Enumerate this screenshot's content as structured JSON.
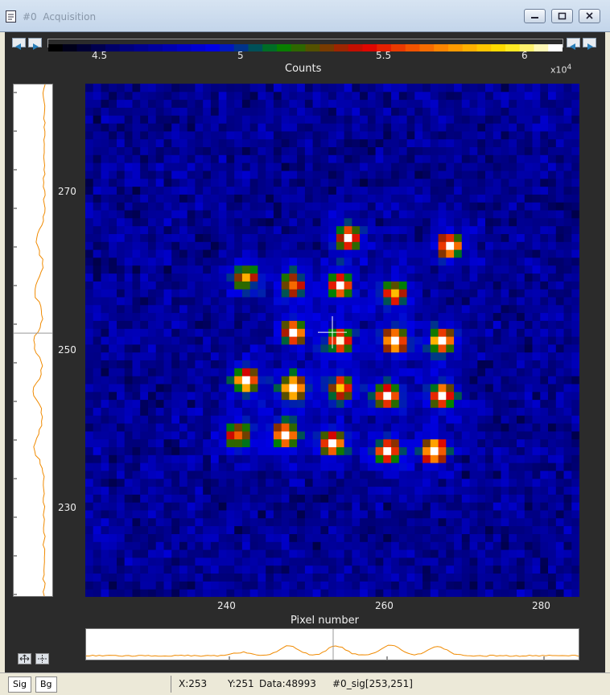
{
  "window": {
    "title": "#0  Acquisition"
  },
  "colorbar": {
    "title": "Counts",
    "exponent_label": "x10",
    "exponent_power": "4",
    "ticks": [
      "4.5",
      "5",
      "5.5",
      "6"
    ]
  },
  "axes": {
    "y_ticks": [
      "270",
      "250",
      "230"
    ],
    "x_ticks": [
      "240",
      "260",
      "280"
    ],
    "x_title": "Pixel number"
  },
  "status": {
    "tab_sig": "Sig",
    "tab_bg": "Bg",
    "x": "X:253",
    "y": "Y:251",
    "data": "Data:48993",
    "ref": "#0_sig[253,251]"
  },
  "colors": {
    "background": "#050c3c",
    "profile_line": "#f08a00",
    "cursor": "#ffffff"
  },
  "cursor": {
    "x": 253,
    "y": 251
  },
  "image_extent": {
    "x": [
      222,
      285
    ],
    "y": [
      218,
      283
    ]
  },
  "peaks": [
    {
      "x": 255,
      "y": 263,
      "v": 0.7
    },
    {
      "x": 268,
      "y": 262,
      "v": 0.75
    },
    {
      "x": 242,
      "y": 258,
      "v": 0.55
    },
    {
      "x": 248,
      "y": 257,
      "v": 0.5
    },
    {
      "x": 254,
      "y": 257,
      "v": 0.7
    },
    {
      "x": 261,
      "y": 256,
      "v": 0.55
    },
    {
      "x": 248,
      "y": 251,
      "v": 0.7
    },
    {
      "x": 254,
      "y": 250,
      "v": 0.7
    },
    {
      "x": 261,
      "y": 250,
      "v": 0.85
    },
    {
      "x": 267,
      "y": 250,
      "v": 0.85
    },
    {
      "x": 242,
      "y": 245,
      "v": 0.8
    },
    {
      "x": 248,
      "y": 244,
      "v": 0.9
    },
    {
      "x": 254,
      "y": 244,
      "v": 0.6
    },
    {
      "x": 260,
      "y": 243,
      "v": 0.7
    },
    {
      "x": 267,
      "y": 243,
      "v": 0.75
    },
    {
      "x": 241,
      "y": 238,
      "v": 0.5
    },
    {
      "x": 247,
      "y": 238,
      "v": 0.75
    },
    {
      "x": 253,
      "y": 237,
      "v": 0.7
    },
    {
      "x": 260,
      "y": 236,
      "v": 0.8
    },
    {
      "x": 266,
      "y": 236,
      "v": 0.95
    }
  ]
}
